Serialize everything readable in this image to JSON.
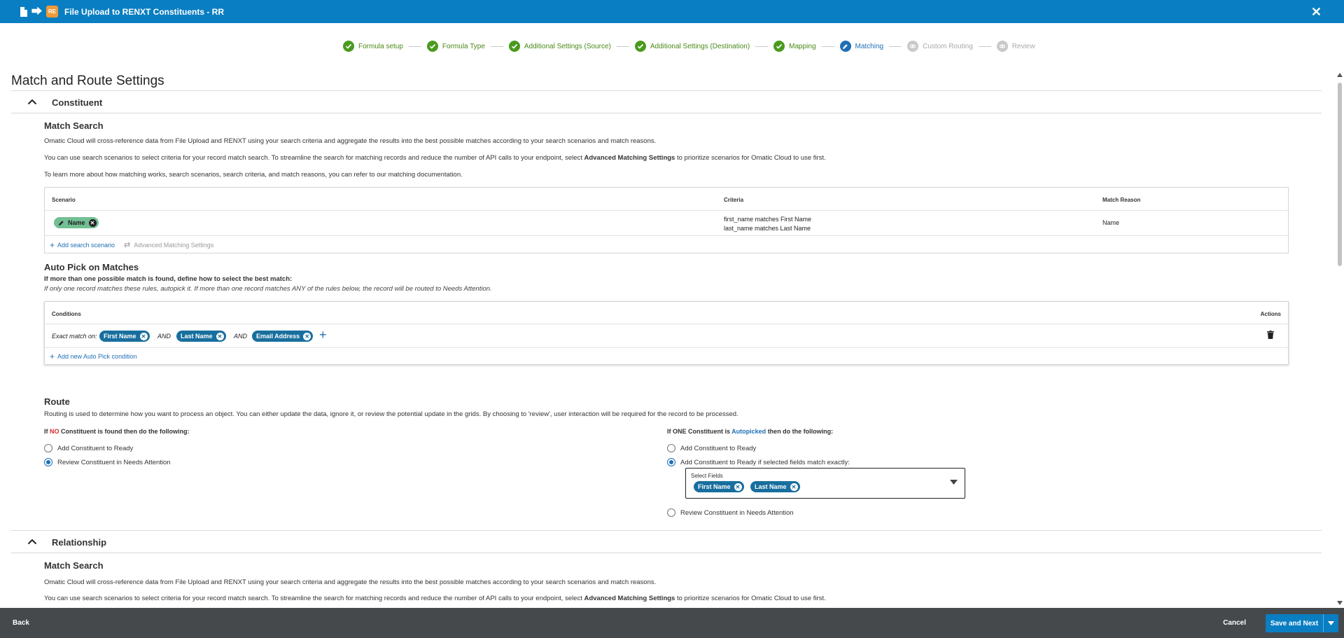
{
  "window": {
    "title": "File Upload to RENXT Constituents - RR",
    "re_badge": "RE"
  },
  "stepper": [
    {
      "label": "Formula setup",
      "state": "done"
    },
    {
      "label": "Formula Type",
      "state": "done"
    },
    {
      "label": "Additional Settings (Source)",
      "state": "done"
    },
    {
      "label": "Additional Settings (Destination)",
      "state": "done"
    },
    {
      "label": "Mapping",
      "state": "done"
    },
    {
      "label": "Matching",
      "state": "active"
    },
    {
      "label": "Custom Routing",
      "state": "todo"
    },
    {
      "label": "Review",
      "state": "todo"
    }
  ],
  "page_title": "Match and Route Settings",
  "constituent": {
    "section_label": "Constituent",
    "match_search": {
      "heading": "Match Search",
      "p1": "Omatic Cloud will cross-reference data from File Upload and RENXT using your search criteria and aggregate the results into the best possible matches according to your search scenarios and match reasons.",
      "p2_pre": "You can use search scenarios to select criteria for your record match search. To streamline the search for matching records and reduce the number of API calls to your endpoint, select ",
      "p2_bold": "Advanced Matching Settings",
      "p2_post": " to prioritize scenarios for Omatic Cloud to use first.",
      "p3": "To learn more about how matching works, search scenarios, search criteria, and match reasons, you can refer to our matching documentation.",
      "col_scenario": "Scenario",
      "col_criteria": "Criteria",
      "col_reason": "Match Reason",
      "scenario_chip": "Name",
      "criteria_1": "first_name matches First Name",
      "criteria_2": "last_name matches Last Name",
      "match_reason": "Name",
      "add_scenario": "Add search scenario",
      "advanced": "Advanced Matching Settings"
    },
    "auto_pick": {
      "heading": "Auto Pick on Matches",
      "subheading": "If more than one possible match is found, define how to select the best match:",
      "note": "If only one record matches these rules, autopick it. If more than one record matches ANY of the rules below, the record will be routed to Needs Attention.",
      "col_conditions": "Conditions",
      "col_actions": "Actions",
      "exact": "Exact match on:",
      "and": "AND",
      "chips": [
        "First Name",
        "Last Name",
        "Email Address"
      ],
      "add_condition": "Add new Auto Pick condition"
    },
    "route": {
      "heading": "Route",
      "desc": "Routing is used to determine how you want to process an object. You can either update the data, ignore it, or review the potential update in the grids. By choosing to 'review', user interaction will be required for the record to be processed.",
      "left_pre": "If ",
      "left_keyword": "NO",
      "left_post": " Constituent is found then do the following:",
      "left_options": [
        "Add Constituent to Ready",
        "Review Constituent in Needs Attention"
      ],
      "right_pre": "If ONE Constituent is ",
      "right_keyword": "Autopicked",
      "right_post": " then do the following:",
      "right_options": [
        "Add Constituent to Ready",
        "Add Constituent to Ready if selected fields match exactly:",
        "Review Constituent in Needs Attention"
      ],
      "select_label": "Select Fields",
      "select_chips": [
        "First Name",
        "Last Name"
      ]
    }
  },
  "relationship": {
    "section_label": "Relationship",
    "heading": "Match Search",
    "p1": "Omatic Cloud will cross-reference data from File Upload and RENXT using your search criteria and aggregate the results into the best possible matches according to your search scenarios and match reasons.",
    "p2_pre": "You can use search scenarios to select criteria for your record match search. To streamline the search for matching records and reduce the number of API calls to your endpoint, select ",
    "p2_bold": "Advanced Matching Settings",
    "p2_post": " to prioritize scenarios for Omatic Cloud to use first."
  },
  "footer": {
    "back": "Back",
    "cancel": "Cancel",
    "save": "Save and Next"
  },
  "colors": {
    "primary": "#0a7ec2",
    "done": "#4a9a1e",
    "chip": "#186f9e",
    "footer": "#45494c",
    "no_red": "#d62b2b"
  }
}
